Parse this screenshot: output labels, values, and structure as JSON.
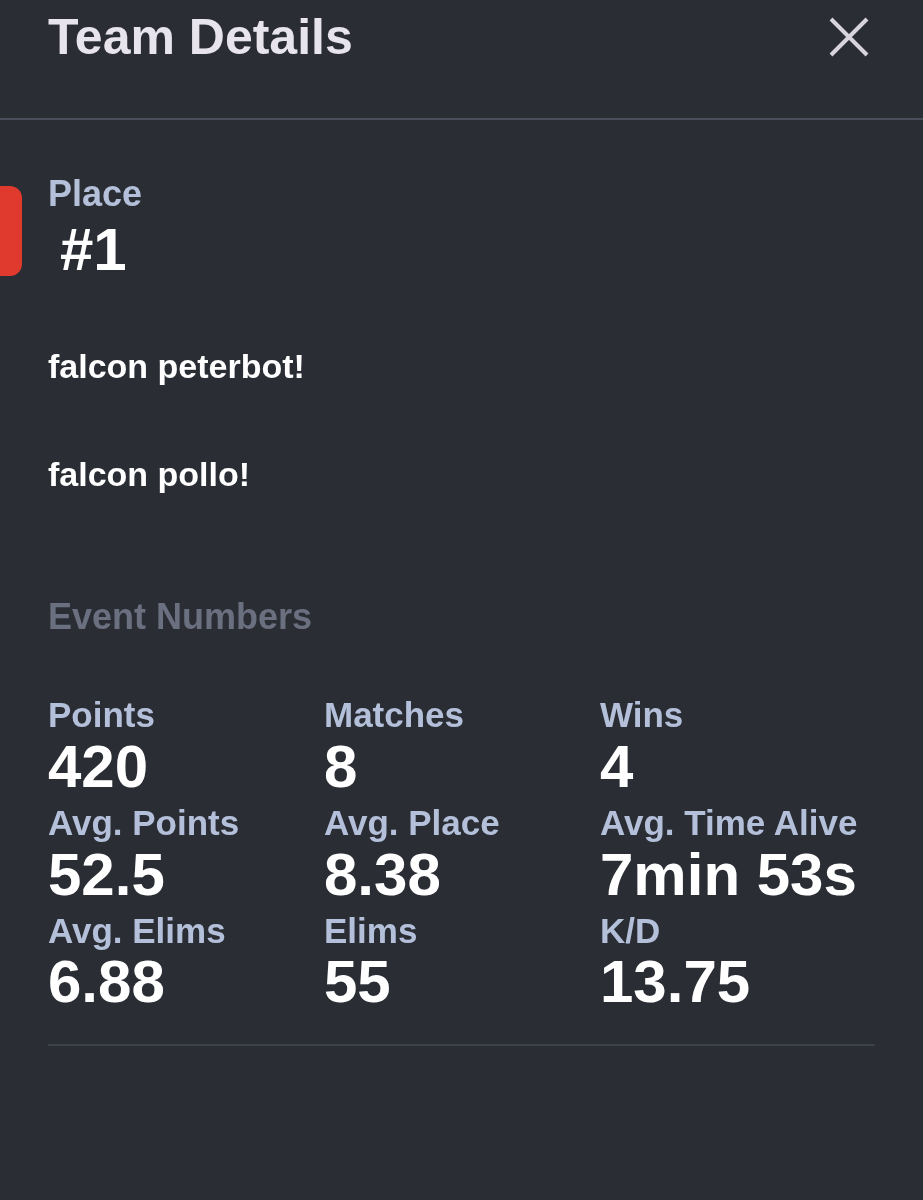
{
  "header": {
    "title": "Team Details"
  },
  "place": {
    "label": "Place",
    "value": "#1"
  },
  "members": [
    "falcon peterbot!",
    "falcon pollo!"
  ],
  "event_numbers": {
    "title": "Event Numbers",
    "stats": [
      {
        "label": "Points",
        "value": "420"
      },
      {
        "label": "Matches",
        "value": "8"
      },
      {
        "label": "Wins",
        "value": "4"
      },
      {
        "label": "Avg. Points",
        "value": "52.5"
      },
      {
        "label": "Avg. Place",
        "value": "8.38"
      },
      {
        "label": "Avg. Time Alive",
        "value": "7min 53s"
      },
      {
        "label": "Avg. Elims",
        "value": "6.88"
      },
      {
        "label": "Elims",
        "value": "55"
      },
      {
        "label": "K/D",
        "value": "13.75"
      }
    ]
  }
}
